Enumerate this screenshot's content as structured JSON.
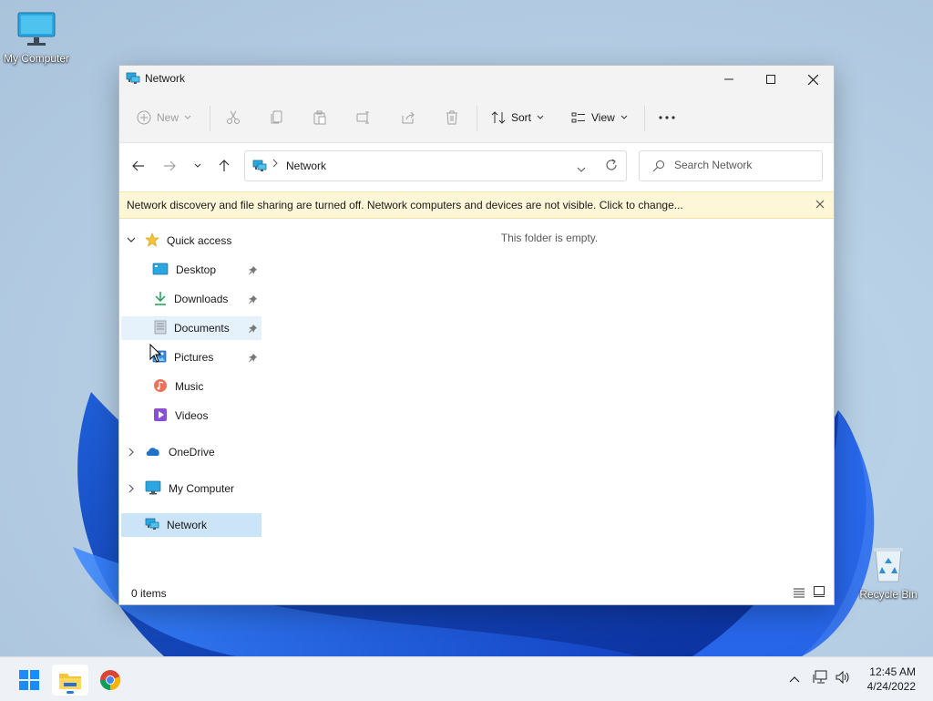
{
  "desktop": {
    "icons": [
      {
        "label": "My Computer"
      },
      {
        "label": "Recycle Bin"
      }
    ]
  },
  "window": {
    "title": "Network",
    "controls": {
      "minimize": "minimize",
      "maximize": "maximize",
      "close": "close"
    }
  },
  "toolbar": {
    "new_label": "New",
    "sort_label": "Sort",
    "view_label": "View"
  },
  "navigation": {
    "address": "Network",
    "search_placeholder": "Search Network"
  },
  "infobar": {
    "message": "Network discovery and file sharing are turned off. Network computers and devices are not visible. Click to change..."
  },
  "sidebar": {
    "quick_access": "Quick access",
    "items": [
      {
        "label": "Desktop",
        "pinned": true
      },
      {
        "label": "Downloads",
        "pinned": true
      },
      {
        "label": "Documents",
        "pinned": true
      },
      {
        "label": "Pictures",
        "pinned": true
      },
      {
        "label": "Music",
        "pinned": false
      },
      {
        "label": "Videos",
        "pinned": false
      }
    ],
    "onedrive": "OneDrive",
    "my_computer": "My Computer",
    "network": "Network"
  },
  "content": {
    "empty_message": "This folder is empty."
  },
  "status": {
    "item_count": "0 items"
  },
  "taskbar": {
    "apps": [
      "start-button",
      "file-explorer",
      "chrome"
    ],
    "clock_time": "12:45 AM",
    "clock_date": "4/24/2022"
  },
  "colors": {
    "accent": "#0067c0",
    "selection": "#cce4f7",
    "hover": "#e5f1fb",
    "infobar": "#fdf7d7"
  }
}
